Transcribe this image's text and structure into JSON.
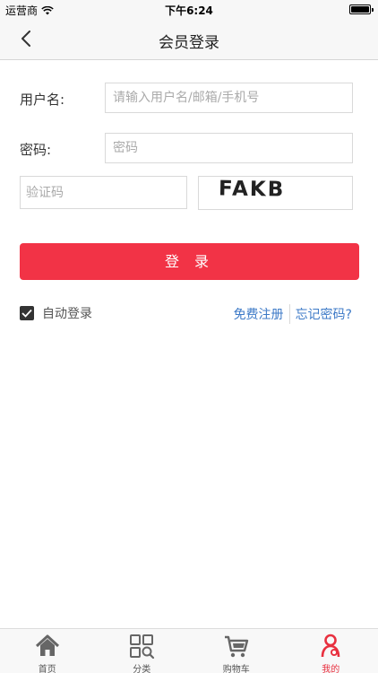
{
  "status_bar": {
    "carrier": "运营商",
    "time": "下午6:24"
  },
  "nav": {
    "title": "会员登录"
  },
  "form": {
    "username_label": "用户名:",
    "username_placeholder": "请输入用户名/邮箱/手机号",
    "password_label": "密码:",
    "password_placeholder": "密码",
    "captcha_placeholder": "验证码",
    "captcha_text": "FAKB"
  },
  "login_button": "登 录",
  "auto_login": {
    "label": "自动登录",
    "checked": true
  },
  "links": {
    "register": "免费注册",
    "forgot": "忘记密码?"
  },
  "tabs": [
    {
      "label": "首页",
      "icon": "home-icon"
    },
    {
      "label": "分类",
      "icon": "category-icon"
    },
    {
      "label": "购物车",
      "icon": "cart-icon"
    },
    {
      "label": "我的",
      "icon": "user-icon",
      "active": true
    }
  ],
  "colors": {
    "accent": "#f23346",
    "link": "#3d7ac7",
    "tab_active": "#e8303f"
  }
}
